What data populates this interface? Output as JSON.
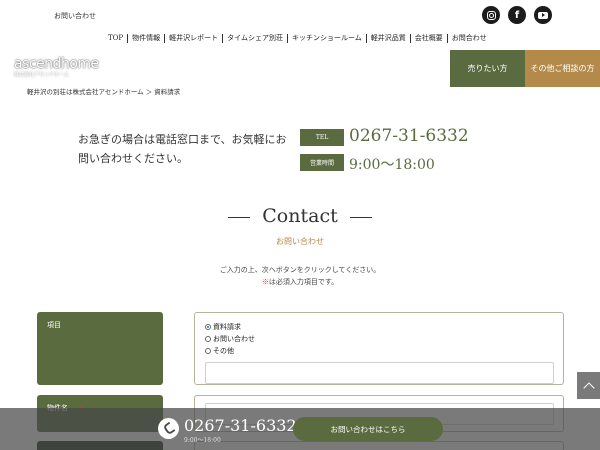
{
  "header": {
    "top_link": "お問い合わせ",
    "social": [
      {
        "icon": "instagram-icon"
      },
      {
        "icon": "facebook-icon",
        "glyph": "f"
      },
      {
        "icon": "youtube-icon"
      }
    ],
    "nav": [
      "TOP",
      "物件情報",
      "軽井沢レポート",
      "タイムシェア別荘",
      "キッチンショールーム",
      "軽井沢品質",
      "会社概要",
      "お問合わせ"
    ],
    "logo": {
      "main": "ascendhome",
      "sub": "株式会社アセンドホーム"
    },
    "breadcrumb": "軽井沢の別荘は株式会社アセンドホーム ＞ 資料請求",
    "sell_button": "売りたい方",
    "other_button": "その他ご相談の方"
  },
  "info": {
    "notice": "お急ぎの場合は電話窓口まで、お気軽にお問い合わせください。",
    "tel_label": "TEL",
    "tel": "0267-31-6332",
    "hours_label": "営業時間",
    "hours": "9:00〜18:00"
  },
  "contact": {
    "title": "Contact",
    "subtitle": "お問い合わせ",
    "guide_line1": "ご入力の上、次へボタンをクリックしてください。",
    "guide_req_mark": "※",
    "guide_line2": "は必須入力項目です。"
  },
  "form": {
    "row1_label": "項目",
    "options": [
      "資料請求",
      "お問い合わせ",
      "その他"
    ],
    "selected_option": "資料請求",
    "row2_label": "物件名",
    "row2_req": "※"
  },
  "bottom_bar": {
    "tel": "0267-31-6332",
    "hours": "9:00〜18:00",
    "contact_button": "お問い合わせはこちら"
  },
  "colors": {
    "brand_green": "#5b6b40",
    "accent_gold": "#b48a4a",
    "required_red": "#c93a3a"
  }
}
